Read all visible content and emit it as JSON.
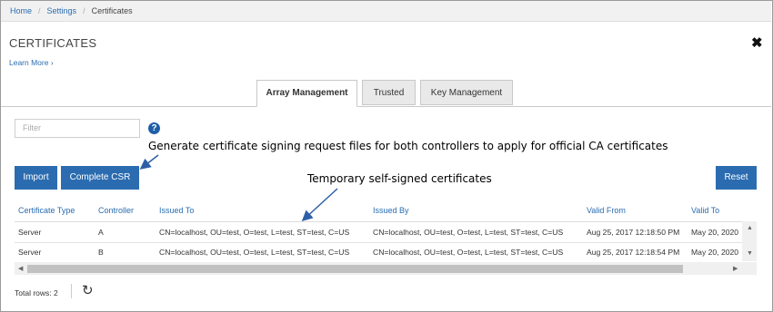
{
  "breadcrumb": [
    "Home",
    "Settings",
    "Certificates"
  ],
  "title": "CERTIFICATES",
  "close_glyph": "✖",
  "learn_more": "Learn More ›",
  "tabs": [
    {
      "label": "Array Management",
      "active": true
    },
    {
      "label": "Trusted",
      "active": false
    },
    {
      "label": "Key Management",
      "active": false
    }
  ],
  "filter": {
    "placeholder": "Filter"
  },
  "help_icon": "?",
  "annotations": {
    "csr": "Generate certificate signing request files for both controllers to apply for official CA certificates",
    "selfsigned": "Temporary self-signed certificates"
  },
  "buttons": {
    "import": "Import",
    "complete_csr": "Complete CSR",
    "reset": "Reset"
  },
  "table": {
    "columns": [
      "Certificate Type",
      "Controller",
      "Issued To",
      "Issued By",
      "Valid From",
      "Valid To"
    ],
    "rows": [
      [
        "Server",
        "A",
        "CN=localhost, OU=test, O=test, L=test, ST=test, C=US",
        "CN=localhost, OU=test, O=test, L=test, ST=test, C=US",
        "Aug 25, 2017 12:18:50 PM",
        "May 20, 2020"
      ],
      [
        "Server",
        "B",
        "CN=localhost, OU=test, O=test, L=test, ST=test, C=US",
        "CN=localhost, OU=test, O=test, L=test, ST=test, C=US",
        "Aug 25, 2017 12:18:54 PM",
        "May 20, 2020"
      ]
    ]
  },
  "footer": {
    "total_rows": "Total rows: 2",
    "refresh_glyph": "↻"
  },
  "colors": {
    "accent": "#2b6cb0",
    "link": "#2a6db0",
    "annotation_arrow": "#2e5fa6"
  }
}
